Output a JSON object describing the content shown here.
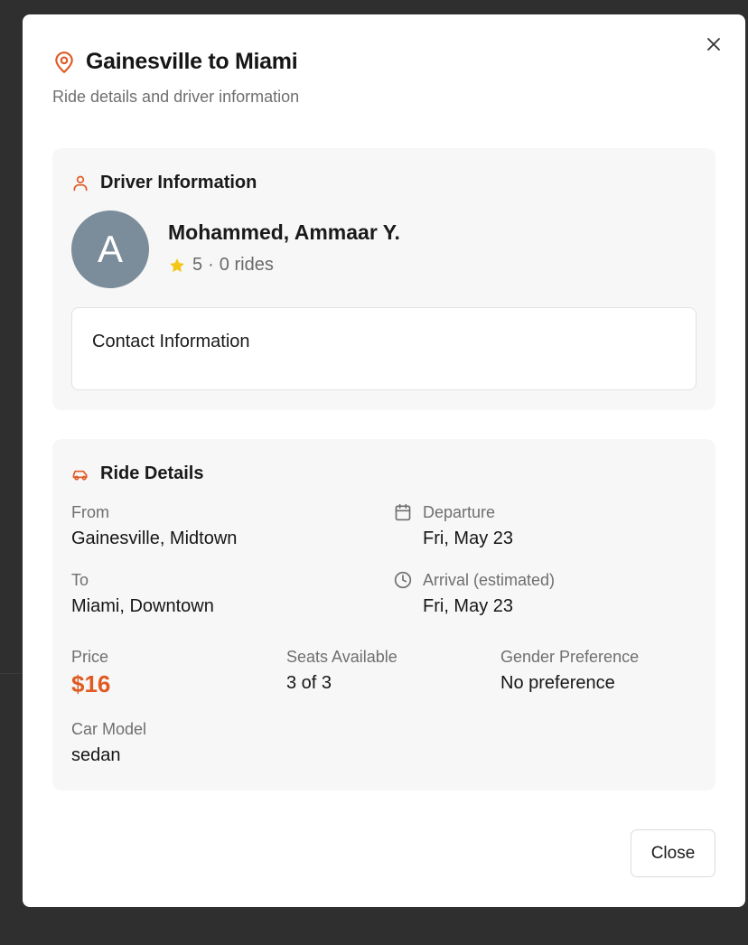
{
  "dialog": {
    "title": "Gainesville to Miami",
    "subtitle": "Ride details and driver information",
    "close_button_label": "Close",
    "title_icon": "map-pin-icon",
    "close_icon": "close-icon"
  },
  "driver": {
    "section_title": "Driver Information",
    "section_icon": "user-icon",
    "avatar_initial": "A",
    "name": "Mohammed, Ammaar Y.",
    "rating": "5",
    "separator": "·",
    "rides": "0 rides",
    "contact_title": "Contact Information"
  },
  "ride": {
    "section_title": "Ride Details",
    "section_icon": "car-icon",
    "from_label": "From",
    "from_value": "Gainesville, Midtown",
    "to_label": "To",
    "to_value": "Miami, Downtown",
    "departure_label": "Departure",
    "departure_value": "Fri, May 23",
    "arrival_label": "Arrival (estimated)",
    "arrival_value": "Fri, May 23",
    "price_label": "Price",
    "price_value": "$16",
    "seats_label": "Seats Available",
    "seats_value": "3 of 3",
    "gender_label": "Gender Preference",
    "gender_value": "No preference",
    "car_label": "Car Model",
    "car_value": "sedan"
  },
  "colors": {
    "accent": "#e05a22",
    "avatar_bg": "#7b8d9b",
    "star": "#f5c518",
    "overlay": "#2f2f2f"
  }
}
